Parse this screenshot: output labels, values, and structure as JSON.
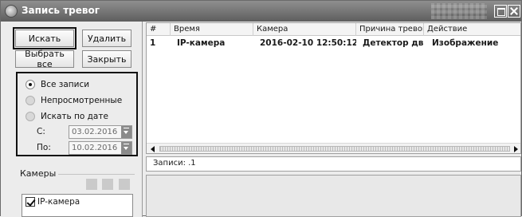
{
  "window": {
    "title": "Запись тревог"
  },
  "toolbar": {
    "search_label": "Искать",
    "delete_label": "Удалить",
    "select_all_label": "Выбрать все",
    "close_label": "Закрыть"
  },
  "filter": {
    "options": [
      {
        "label": "Все записи",
        "checked": true,
        "enabled": true
      },
      {
        "label": "Непросмотренные",
        "checked": false,
        "enabled": false
      },
      {
        "label": "Искать по дате",
        "checked": false,
        "enabled": false
      }
    ],
    "from_label": "С:",
    "from_value": "03.02.2016",
    "to_label": "По:",
    "to_value": "10.02.2016"
  },
  "cameras": {
    "title": "Камеры",
    "items": [
      {
        "label": "IP-камера",
        "checked": true
      }
    ]
  },
  "table": {
    "columns": [
      "#",
      "Время",
      "Камера",
      "Причина тревоги",
      "Действие"
    ],
    "rows": [
      [
        "1",
        "IP-камера",
        "2016-02-10 12:50:12",
        "Детектор дв...",
        "Изображение"
      ]
    ]
  },
  "status": {
    "records_text": "Записи: .1"
  }
}
